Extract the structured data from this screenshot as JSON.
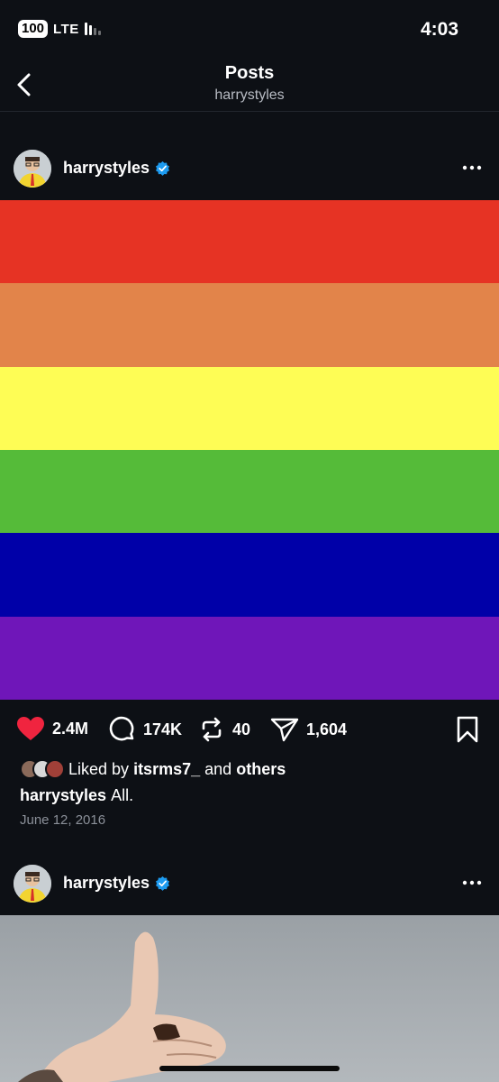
{
  "status": {
    "battery": "100",
    "carrier": "LTE",
    "time": "4:03"
  },
  "nav": {
    "title": "Posts",
    "subtitle": "harrystyles"
  },
  "posts": [
    {
      "author": "harrystyles",
      "verified": true,
      "image": "rainbow-flag",
      "flag_colors": [
        "#e63324",
        "#e2844a",
        "#fefd55",
        "#55bb39",
        "#0000a8",
        "#6f16b9"
      ],
      "likes": "2.4M",
      "comments": "174K",
      "reposts": "40",
      "shares": "1,604",
      "liked_prefix": "Liked by",
      "liked_user": "itsrms7_",
      "liked_and": "and",
      "liked_others": "others",
      "caption_author": "harrystyles",
      "caption_text": "All.",
      "date": "June 12, 2016"
    },
    {
      "author": "harrystyles",
      "verified": true,
      "image": "thumbs-up-photo"
    }
  ],
  "colors": {
    "background": "#0d1015",
    "like": "#f0243f",
    "verified": "#1d9bf0"
  }
}
